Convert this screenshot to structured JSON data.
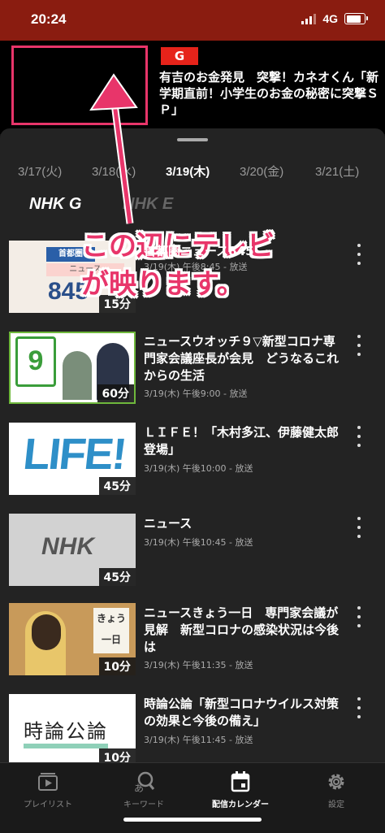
{
  "status": {
    "time": "20:24",
    "network": "4G"
  },
  "now_playing": {
    "channel": "G",
    "title": "有吉のお金発見　突撃！カネオくん「新学期直前！小学生のお金の秘密に突撃ＳＰ」"
  },
  "dates": [
    "3/17(火)",
    "3/18(水)",
    "3/19(木)",
    "3/20(金)",
    "3/21(土)"
  ],
  "selected_date": "3/19(木)",
  "channels": [
    {
      "label": "NHK G"
    },
    {
      "label": "NHK E"
    }
  ],
  "programs": [
    {
      "title": "首都圏ニュース845",
      "meta": "3/19(木) 午後8:45 - 放送",
      "duration": "15分",
      "thumb_text": "首都圏ニュース845"
    },
    {
      "title": "ニュースウオッチ９▽新型コロナ専門家会議座長が会見　どうなるこれからの生活",
      "meta": "3/19(木) 午後9:00 - 放送",
      "duration": "60分",
      "thumb_text": "NEWS WATCH 9"
    },
    {
      "title": "ＬＩＦＥ！「木村多江、伊藤健太郎　登場」",
      "meta": "3/19(木) 午後10:00 - 放送",
      "duration": "45分",
      "thumb_text": "LIFE!"
    },
    {
      "title": "ニュース",
      "meta": "3/19(木) 午後10:45 - 放送",
      "duration": "45分",
      "thumb_text": "NHK"
    },
    {
      "title": "ニュースきょう一日　専門家会議が見解　新型コロナの感染状況は今後は",
      "meta": "3/19(木) 午後11:35 - 放送",
      "duration": "10分",
      "thumb_text": "きょう一日"
    },
    {
      "title": "時論公論「新型コロナウイルス対策の効果と今後の備え」",
      "meta": "3/19(木) 午後11:45 - 放送",
      "duration": "10分",
      "thumb_text": "時論公論"
    }
  ],
  "annotation": {
    "line1": "この辺にテレビ",
    "line2": "が映ります。"
  },
  "tabs": [
    {
      "label": "プレイリスト",
      "icon": "playlist-icon"
    },
    {
      "label": "キーワード",
      "icon": "keyword-search-icon"
    },
    {
      "label": "配信カレンダー",
      "icon": "calendar-icon"
    },
    {
      "label": "設定",
      "icon": "gear-icon"
    }
  ],
  "colors": {
    "accent": "#e8356a",
    "statusbar": "#8a1c10",
    "badge": "#e6231a"
  }
}
